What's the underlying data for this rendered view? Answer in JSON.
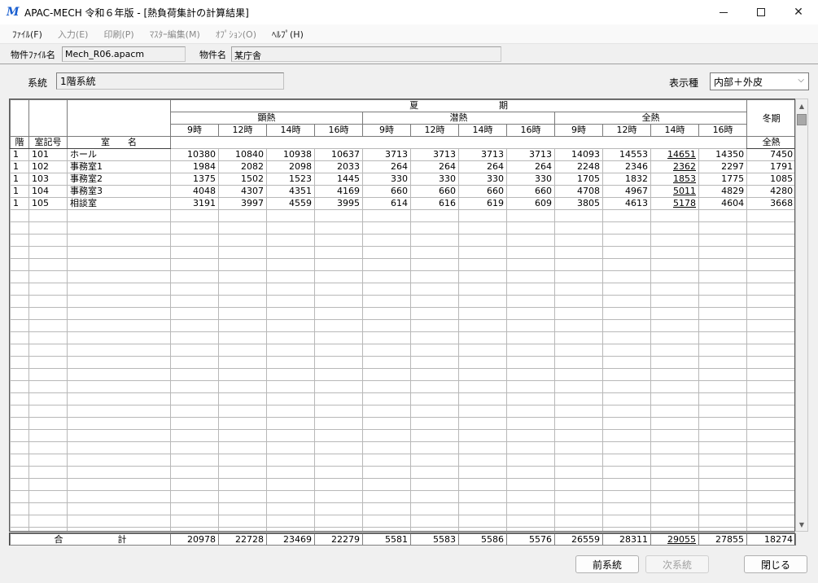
{
  "window": {
    "title": "APAC-MECH 令和６年版 - [熱負荷集計の計算結果]"
  },
  "menu": [
    {
      "label": "ﾌｧｲﾙ(F)",
      "enabled": true
    },
    {
      "label": "入力(E)",
      "enabled": false
    },
    {
      "label": "印刷(P)",
      "enabled": false
    },
    {
      "label": "ﾏｽﾀｰ編集(M)",
      "enabled": false
    },
    {
      "label": "ｵﾌﾟｼｮﾝ(O)",
      "enabled": false
    },
    {
      "label": "ﾍﾙﾌﾟ(H)",
      "enabled": true
    }
  ],
  "info": {
    "file_label": "物件ﾌｧｲﾙ名",
    "file_value": "Mech_R06.apacm",
    "name_label": "物件名",
    "name_value": "某庁舎"
  },
  "system": {
    "label": "系統",
    "value": "1階系統"
  },
  "display": {
    "label": "表示種",
    "value": "内部＋外皮"
  },
  "header": {
    "floor": "階",
    "room_no": "室記号",
    "room_name": "室　　名",
    "summer": "夏　　　　　　　　　期",
    "sensible": "顕熱",
    "latent": "潜熱",
    "total": "全熱",
    "winter": "冬期",
    "winter_total": "全熱",
    "times": [
      "9時",
      "12時",
      "14時",
      "16時"
    ]
  },
  "rows": [
    {
      "floor": "1",
      "no": "101",
      "name": "ホール",
      "sensible": [
        "10380",
        "10840",
        "10938",
        "10637"
      ],
      "latent": [
        "3713",
        "3713",
        "3713",
        "3713"
      ],
      "total": [
        "14093",
        "14553",
        "14651",
        "14350"
      ],
      "winter": "7450"
    },
    {
      "floor": "1",
      "no": "102",
      "name": "事務室1",
      "sensible": [
        "1984",
        "2082",
        "2098",
        "2033"
      ],
      "latent": [
        "264",
        "264",
        "264",
        "264"
      ],
      "total": [
        "2248",
        "2346",
        "2362",
        "2297"
      ],
      "winter": "1791"
    },
    {
      "floor": "1",
      "no": "103",
      "name": "事務室2",
      "sensible": [
        "1375",
        "1502",
        "1523",
        "1445"
      ],
      "latent": [
        "330",
        "330",
        "330",
        "330"
      ],
      "total": [
        "1705",
        "1832",
        "1853",
        "1775"
      ],
      "winter": "1085"
    },
    {
      "floor": "1",
      "no": "104",
      "name": "事務室3",
      "sensible": [
        "4048",
        "4307",
        "4351",
        "4169"
      ],
      "latent": [
        "660",
        "660",
        "660",
        "660"
      ],
      "total": [
        "4708",
        "4967",
        "5011",
        "4829"
      ],
      "winter": "4280"
    },
    {
      "floor": "1",
      "no": "105",
      "name": "相談室",
      "sensible": [
        "3191",
        "3997",
        "4559",
        "3995"
      ],
      "latent": [
        "614",
        "616",
        "619",
        "609"
      ],
      "total": [
        "3805",
        "4613",
        "5178",
        "4604"
      ],
      "winter": "3668"
    }
  ],
  "totals": {
    "label_a": "合",
    "label_b": "計",
    "sensible": [
      "20978",
      "22728",
      "23469",
      "22279"
    ],
    "latent": [
      "5581",
      "5583",
      "5586",
      "5576"
    ],
    "total": [
      "26559",
      "28311",
      "29055",
      "27855"
    ],
    "winter": "18274"
  },
  "buttons": {
    "prev": "前系統",
    "next": "次系統",
    "close": "閉じる"
  }
}
